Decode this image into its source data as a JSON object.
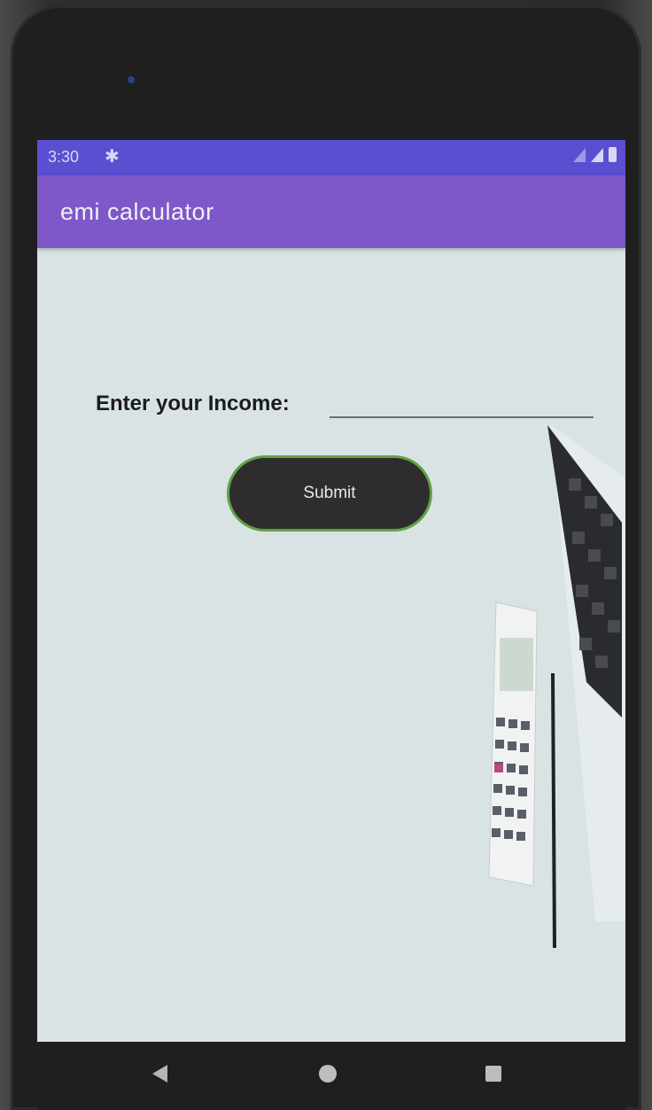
{
  "status_bar": {
    "time": "3:30",
    "settings_icon": "gear-icon",
    "indicators": [
      "wifi-icon",
      "signal-icon",
      "battery-icon"
    ]
  },
  "app_bar": {
    "title": "emi calculator"
  },
  "form": {
    "income_label": "Enter your Income:",
    "income_value": "",
    "submit_label": "Submit"
  },
  "nav_bar": {
    "buttons": [
      "back-icon",
      "home-icon",
      "recents-icon"
    ]
  },
  "colors": {
    "status_bar": "#5a4fd0",
    "app_bar": "#7e58c9",
    "screen_background": "#d9e3e4",
    "button_fill": "#2f2c2e",
    "button_border": "#5ea346"
  }
}
